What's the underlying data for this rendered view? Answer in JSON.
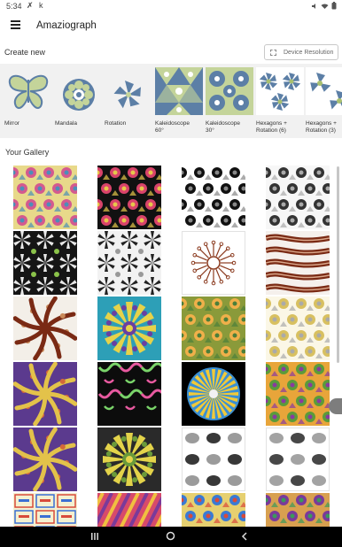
{
  "status_bar": {
    "time": "5:34",
    "left_icons": "✗ k"
  },
  "app_bar": {
    "title": "Amaziograph"
  },
  "create_new": {
    "title": "Create new",
    "device_resolution_label": "Device Resolution",
    "items": [
      {
        "label_1": "Mirror",
        "label_2": ""
      },
      {
        "label_1": "Mandala",
        "label_2": ""
      },
      {
        "label_1": "Rotation",
        "label_2": ""
      },
      {
        "label_1": "Kaleidoscope",
        "label_2": "60°"
      },
      {
        "label_1": "Kaleidoscope",
        "label_2": "30°"
      },
      {
        "label_1": "Hexagons +",
        "label_2": "Rotation (6)"
      },
      {
        "label_1": "Hexagons +",
        "label_2": "Rotation (3)"
      }
    ]
  },
  "gallery": {
    "title": "Your Gallery",
    "tiles": [
      {
        "bg": "#e8d98a",
        "fg": "#d35a8f",
        "accent": "#4b8fb8",
        "motif": "hex"
      },
      {
        "bg": "#111111",
        "fg": "#d8436a",
        "accent": "#e6c84a",
        "motif": "hex"
      },
      {
        "bg": "#ffffff",
        "fg": "#111111",
        "accent": "#888888",
        "motif": "hex"
      },
      {
        "bg": "#f7f7f7",
        "fg": "#333333",
        "accent": "#aaaaaa",
        "motif": "hex"
      },
      {
        "bg": "#151515",
        "fg": "#e8e8e8",
        "accent": "#8bc34a",
        "motif": "star"
      },
      {
        "bg": "#f2f2f2",
        "fg": "#222222",
        "accent": "#999999",
        "motif": "star"
      },
      {
        "bg": "#ffffff",
        "fg": "#8b3a1e",
        "accent": "#8b3a1e",
        "motif": "sun"
      },
      {
        "bg": "#f5f0ec",
        "fg": "#7a2a14",
        "accent": "#d9a68a",
        "motif": "waves"
      },
      {
        "bg": "#f3efe8",
        "fg": "#7a2a14",
        "accent": "#c98a5a",
        "motif": "swirl"
      },
      {
        "bg": "#2d9fb7",
        "fg": "#e6d24a",
        "accent": "#6a3fa0",
        "motif": "mandala"
      },
      {
        "bg": "#8a9a3a",
        "fg": "#f0b04a",
        "accent": "#4b7f3a",
        "motif": "hex"
      },
      {
        "bg": "#fbf7e6",
        "fg": "#d8c060",
        "accent": "#aaaaaa",
        "motif": "hex"
      },
      {
        "bg": "#5b3a8e",
        "fg": "#e3c24a",
        "accent": "#d3683a",
        "motif": "swirl"
      },
      {
        "bg": "#0c0c0c",
        "fg": "#e85aa0",
        "accent": "#7ad46a",
        "motif": "squiggle"
      },
      {
        "bg": "#000000",
        "fg": "#f0c93a",
        "accent": "#3a8fd4",
        "motif": "sun-disc"
      },
      {
        "bg": "#e8a53a",
        "fg": "#5b9b3a",
        "accent": "#8a3aa0",
        "motif": "hex"
      },
      {
        "bg": "#5b3a8e",
        "fg": "#e3c24a",
        "accent": "#d3683a",
        "motif": "swirl"
      },
      {
        "bg": "#2a2a2a",
        "fg": "#e3d34a",
        "accent": "#6a9a3a",
        "motif": "mandala"
      },
      {
        "bg": "#ffffff",
        "fg": "#222222",
        "accent": "#aaaaaa",
        "motif": "blobs"
      },
      {
        "bg": "#ffffff",
        "fg": "#333333",
        "accent": "#aaaaaa",
        "motif": "blobs"
      },
      {
        "bg": "#f4f0d0",
        "fg": "#3a6fd4",
        "accent": "#d84a3a",
        "motif": "text-tiles"
      },
      {
        "bg": "#d84a6a",
        "fg": "#f0c040",
        "accent": "#7a3a9a",
        "motif": "stripes"
      },
      {
        "bg": "#e6d070",
        "fg": "#3a7ad4",
        "accent": "#d84a3a",
        "motif": "hex"
      },
      {
        "bg": "#d8a050",
        "fg": "#7a3a9a",
        "accent": "#3a9a5a",
        "motif": "hex"
      }
    ]
  },
  "icons": {
    "menu": "hamburger-menu-icon",
    "device_resolution": "device-resolution-icon",
    "nav_recents": "recents-icon",
    "nav_home": "home-icon",
    "nav_back": "back-icon"
  },
  "colors": {
    "strip_bg": "#f1f1f1",
    "thumb_blue": "#5c7fa6",
    "thumb_green": "#a8c070",
    "nav_bg": "#000000"
  }
}
